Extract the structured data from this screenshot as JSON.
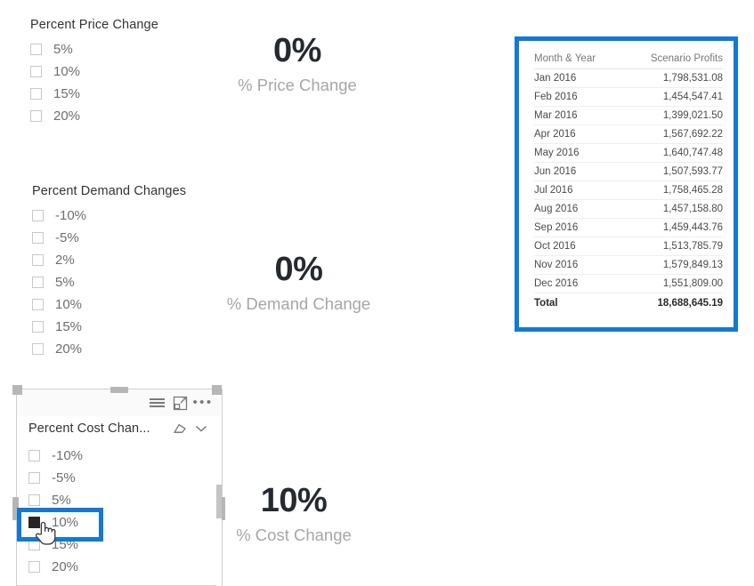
{
  "canvas": {
    "background": "#ffffff",
    "accent_blue": "#1279d5"
  },
  "slicers": [
    {
      "id": "price",
      "title": "Percent Price Change",
      "items": [
        {
          "label": "5%",
          "checked": false
        },
        {
          "label": "10%",
          "checked": false
        },
        {
          "label": "15%",
          "checked": false
        },
        {
          "label": "20%",
          "checked": false
        }
      ]
    },
    {
      "id": "demand",
      "title": "Percent Demand Changes",
      "items": [
        {
          "label": "-10%",
          "checked": false
        },
        {
          "label": "-5%",
          "checked": false
        },
        {
          "label": "2%",
          "checked": false
        },
        {
          "label": "5%",
          "checked": false
        },
        {
          "label": "10%",
          "checked": false
        },
        {
          "label": "15%",
          "checked": false
        },
        {
          "label": "20%",
          "checked": false
        }
      ]
    },
    {
      "id": "cost",
      "title": "Percent Cost Chan...",
      "title_full": "Percent Cost Change",
      "selected": true,
      "items": [
        {
          "label": "-10%",
          "checked": false
        },
        {
          "label": "-5%",
          "checked": false
        },
        {
          "label": "5%",
          "checked": false
        },
        {
          "label": "10%",
          "checked": true
        },
        {
          "label": "15%",
          "checked": false
        },
        {
          "label": "20%",
          "checked": false
        }
      ],
      "header_icons": [
        "hamburger-filter-icon",
        "focus-mode-icon",
        "more-options-icon"
      ],
      "field_icons": [
        "eraser-clear-selections-icon",
        "chevron-down-icon"
      ]
    }
  ],
  "cards": [
    {
      "id": "price_card",
      "value": "0%",
      "caption": "% Price Change"
    },
    {
      "id": "demand_card",
      "value": "0%",
      "caption": "% Demand Change"
    },
    {
      "id": "cost_card",
      "value": "10%",
      "caption": "% Cost Change"
    }
  ],
  "table": {
    "columns": [
      "Month & Year",
      "Scenario Profits"
    ],
    "rows": [
      [
        "Jan 2016",
        "1,798,531.08"
      ],
      [
        "Feb 2016",
        "1,454,547.41"
      ],
      [
        "Mar 2016",
        "1,399,021.50"
      ],
      [
        "Apr 2016",
        "1,567,692.22"
      ],
      [
        "May 2016",
        "1,640,747.48"
      ],
      [
        "Jun 2016",
        "1,507,593.77"
      ],
      [
        "Jul 2016",
        "1,758,465.28"
      ],
      [
        "Aug 2016",
        "1,457,158.80"
      ],
      [
        "Sep 2016",
        "1,459,443.76"
      ],
      [
        "Oct 2016",
        "1,513,785.79"
      ],
      [
        "Nov 2016",
        "1,579,849.13"
      ],
      [
        "Dec 2016",
        "1,551,809.00"
      ]
    ],
    "total_label": "Total",
    "total_value": "18,688,645.19"
  }
}
